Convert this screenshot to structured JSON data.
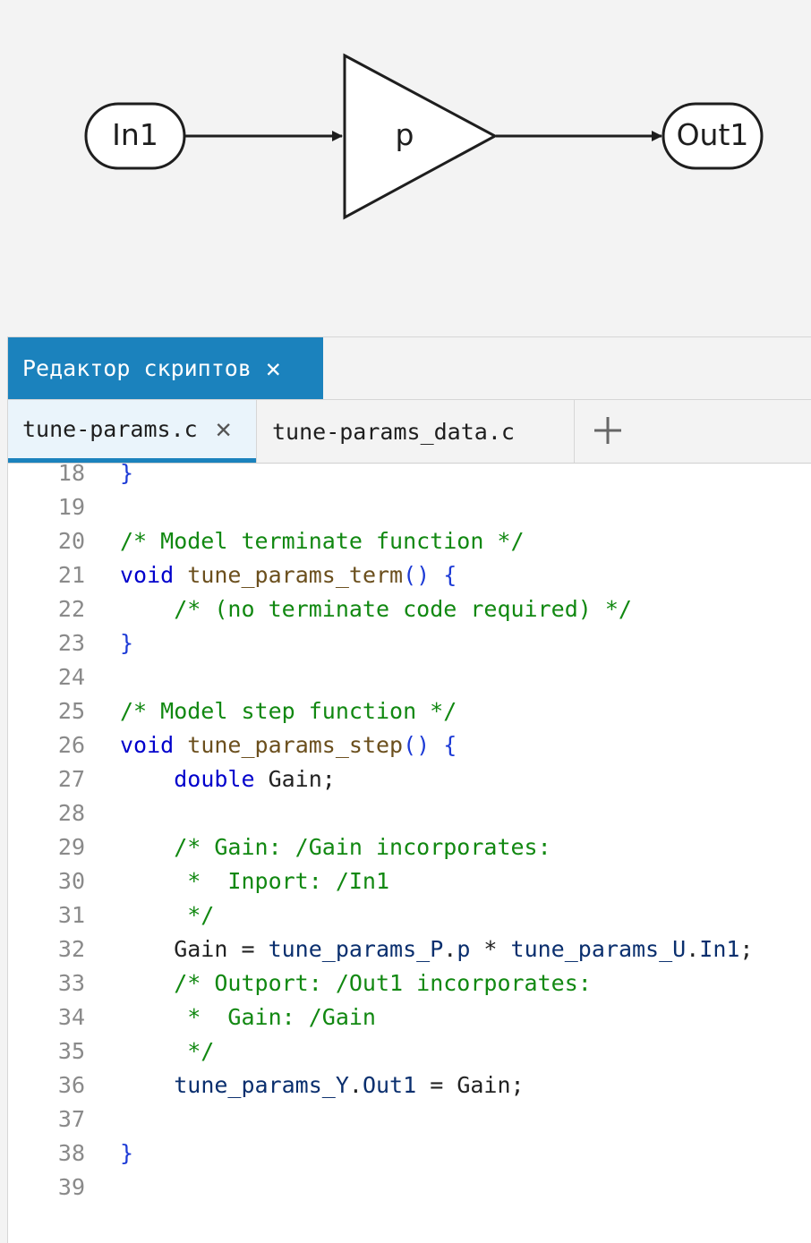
{
  "diagram": {
    "input_port": "In1",
    "gain_block": "p",
    "output_port": "Out1"
  },
  "editor": {
    "panel_title": "Редактор скриптов",
    "tabs": [
      {
        "label": "tune-params.c",
        "active": true
      },
      {
        "label": "tune-params_data.c",
        "active": false
      }
    ],
    "colors": {
      "accent": "#1b82bd",
      "comment": "#118811",
      "keyword": "#0000cc",
      "function": "#6b4f1d",
      "punctuation": "#1d3bd6",
      "identifier": "#0a2f6e"
    },
    "lines": [
      {
        "n": "18",
        "tokens": [
          {
            "t": "}",
            "k": "punct"
          }
        ]
      },
      {
        "n": "19",
        "tokens": []
      },
      {
        "n": "20",
        "tokens": [
          {
            "t": "/* Model terminate function */",
            "k": "comment"
          }
        ]
      },
      {
        "n": "21",
        "tokens": [
          {
            "t": "void",
            "k": "keyword"
          },
          {
            "t": " ",
            "k": "plain"
          },
          {
            "t": "tune_params_term",
            "k": "func"
          },
          {
            "t": "()",
            "k": "punct"
          },
          {
            "t": " ",
            "k": "plain"
          },
          {
            "t": "{",
            "k": "punct"
          }
        ]
      },
      {
        "n": "22",
        "tokens": [
          {
            "t": "    ",
            "k": "plain"
          },
          {
            "t": "/* (no terminate code required) */",
            "k": "comment"
          }
        ]
      },
      {
        "n": "23",
        "tokens": [
          {
            "t": "}",
            "k": "punct"
          }
        ]
      },
      {
        "n": "24",
        "tokens": []
      },
      {
        "n": "25",
        "tokens": [
          {
            "t": "/* Model step function */",
            "k": "comment"
          }
        ]
      },
      {
        "n": "26",
        "tokens": [
          {
            "t": "void",
            "k": "keyword"
          },
          {
            "t": " ",
            "k": "plain"
          },
          {
            "t": "tune_params_step",
            "k": "func"
          },
          {
            "t": "()",
            "k": "punct"
          },
          {
            "t": " ",
            "k": "plain"
          },
          {
            "t": "{",
            "k": "punct"
          }
        ]
      },
      {
        "n": "27",
        "tokens": [
          {
            "t": "    ",
            "k": "plain"
          },
          {
            "t": "double",
            "k": "keyword"
          },
          {
            "t": " Gain;",
            "k": "plain"
          }
        ]
      },
      {
        "n": "28",
        "tokens": []
      },
      {
        "n": "29",
        "tokens": [
          {
            "t": "    ",
            "k": "plain"
          },
          {
            "t": "/* Gain: /Gain incorporates:",
            "k": "comment"
          }
        ]
      },
      {
        "n": "30",
        "tokens": [
          {
            "t": "     *  Inport: /In1",
            "k": "comment"
          }
        ]
      },
      {
        "n": "31",
        "tokens": [
          {
            "t": "     */",
            "k": "comment"
          }
        ]
      },
      {
        "n": "32",
        "tokens": [
          {
            "t": "    Gain = ",
            "k": "plain"
          },
          {
            "t": "tune_params_P",
            "k": "ident"
          },
          {
            "t": ".",
            "k": "plain"
          },
          {
            "t": "p",
            "k": "ident"
          },
          {
            "t": " * ",
            "k": "plain"
          },
          {
            "t": "tune_params_U",
            "k": "ident"
          },
          {
            "t": ".",
            "k": "plain"
          },
          {
            "t": "In1",
            "k": "ident"
          },
          {
            "t": ";",
            "k": "plain"
          }
        ]
      },
      {
        "n": "33",
        "tokens": [
          {
            "t": "    ",
            "k": "plain"
          },
          {
            "t": "/* Outport: /Out1 incorporates:",
            "k": "comment"
          }
        ]
      },
      {
        "n": "34",
        "tokens": [
          {
            "t": "     *  Gain: /Gain",
            "k": "comment"
          }
        ]
      },
      {
        "n": "35",
        "tokens": [
          {
            "t": "     */",
            "k": "comment"
          }
        ]
      },
      {
        "n": "36",
        "tokens": [
          {
            "t": "    ",
            "k": "plain"
          },
          {
            "t": "tune_params_Y",
            "k": "ident"
          },
          {
            "t": ".",
            "k": "plain"
          },
          {
            "t": "Out1",
            "k": "ident"
          },
          {
            "t": " = Gain;",
            "k": "plain"
          }
        ]
      },
      {
        "n": "37",
        "tokens": []
      },
      {
        "n": "38",
        "tokens": [
          {
            "t": "}",
            "k": "punct"
          }
        ]
      },
      {
        "n": "39",
        "tokens": []
      }
    ]
  },
  "icons": {
    "close_panel": "close-icon",
    "close_tab": "close-icon",
    "add_tab": "plus-icon"
  }
}
